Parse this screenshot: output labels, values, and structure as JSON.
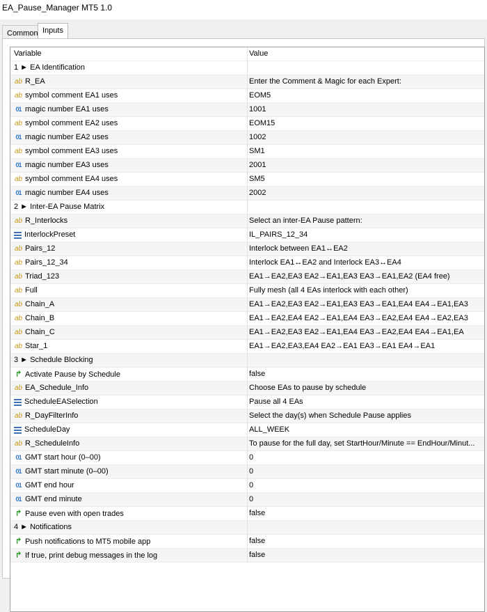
{
  "window": {
    "title": "EA_Pause_Manager MT5 1.0"
  },
  "tabs": [
    {
      "label": "Common"
    },
    {
      "label": "Inputs"
    }
  ],
  "table": {
    "headers": {
      "variable": "Variable",
      "value": "Value"
    },
    "rows": [
      {
        "kind": "group",
        "variable": "1 ► EA Identification",
        "value": ""
      },
      {
        "kind": "ab",
        "variable": "R_EA",
        "value": "Enter the Comment & Magic for each Expert:"
      },
      {
        "kind": "ab",
        "variable": "symbol comment EA1 uses",
        "value": "EOM5"
      },
      {
        "kind": "num",
        "variable": "magic number EA1 uses",
        "value": "1001"
      },
      {
        "kind": "ab",
        "variable": "symbol comment EA2 uses",
        "value": "EOM15"
      },
      {
        "kind": "num",
        "variable": "magic number EA2 uses",
        "value": "1002"
      },
      {
        "kind": "ab",
        "variable": "symbol comment EA3 uses",
        "value": "SM1"
      },
      {
        "kind": "num",
        "variable": "magic number EA3 uses",
        "value": "2001"
      },
      {
        "kind": "ab",
        "variable": "symbol comment EA4 uses",
        "value": "SM5"
      },
      {
        "kind": "num",
        "variable": "magic number EA4 uses",
        "value": "2002"
      },
      {
        "kind": "group",
        "variable": "2 ► Inter-EA Pause Matrix",
        "value": ""
      },
      {
        "kind": "ab",
        "variable": "R_Interlocks",
        "value": "Select an inter-EA Pause pattern:"
      },
      {
        "kind": "enum",
        "variable": "InterlockPreset",
        "value": "IL_PAIRS_12_34"
      },
      {
        "kind": "ab",
        "variable": "Pairs_12",
        "value": "Interlock between EA1↔EA2"
      },
      {
        "kind": "ab",
        "variable": "Pairs_12_34",
        "value": "Interlock EA1↔EA2  and Interlock  EA3↔EA4"
      },
      {
        "kind": "ab",
        "variable": "Triad_123",
        "value": "EA1→EA2,EA3  EA2→EA1,EA3  EA3→EA1,EA2  (EA4 free)"
      },
      {
        "kind": "ab",
        "variable": "Full",
        "value": "Fully mesh (all 4 EAs interlock with each other)"
      },
      {
        "kind": "ab",
        "variable": "Chain_A",
        "value": "EA1→EA2,EA3  EA2→EA1,EA3  EA3→EA1,EA4  EA4→EA1,EA3"
      },
      {
        "kind": "ab",
        "variable": "Chain_B",
        "value": "EA1→EA2,EA4  EA2→EA1,EA4  EA3→EA2,EA4  EA4→EA2,EA3"
      },
      {
        "kind": "ab",
        "variable": "Chain_C",
        "value": "EA1→EA2,EA3  EA2→EA1,EA4  EA3→EA2,EA4  EA4→EA1,EA"
      },
      {
        "kind": "ab",
        "variable": "Star_1",
        "value": "EA1→EA2,EA3,EA4  EA2→EA1  EA3→EA1  EA4→EA1"
      },
      {
        "kind": "group",
        "variable": "3 ► Schedule Blocking",
        "value": ""
      },
      {
        "kind": "bool",
        "variable": "Activate Pause by Schedule",
        "value": "false"
      },
      {
        "kind": "ab",
        "variable": "EA_Schedule_Info",
        "value": "Choose EAs to pause by schedule"
      },
      {
        "kind": "enum",
        "variable": "ScheduleEASelection",
        "value": "Pause all 4 EAs"
      },
      {
        "kind": "ab",
        "variable": "R_DayFilterInfo",
        "value": "Select the day(s) when Schedule Pause applies"
      },
      {
        "kind": "enum",
        "variable": "ScheduleDay",
        "value": "ALL_WEEK"
      },
      {
        "kind": "ab",
        "variable": "R_ScheduleInfo",
        "value": "To pause for the full day, set StartHour/Minute == EndHour/Minut..."
      },
      {
        "kind": "num",
        "variable": "GMT start hour (0–00)",
        "value": "0"
      },
      {
        "kind": "num",
        "variable": "GMT start minute (0–00)",
        "value": "0"
      },
      {
        "kind": "num",
        "variable": "GMT end hour",
        "value": "0"
      },
      {
        "kind": "num",
        "variable": "GMT end minute",
        "value": "0"
      },
      {
        "kind": "bool",
        "variable": "Pause even with open trades",
        "value": "false"
      },
      {
        "kind": "group",
        "variable": "4 ► Notifications",
        "value": ""
      },
      {
        "kind": "bool",
        "variable": "Push notifications to MT5 mobile app",
        "value": "false"
      },
      {
        "kind": "bool",
        "variable": "If true, print debug messages in the log",
        "value": "false"
      }
    ]
  },
  "icons": {
    "ab": "string-ab-icon",
    "num": "integer-01-icon",
    "enum": "enum-list-icon",
    "bool": "bool-arrow-icon"
  },
  "icon_text": {
    "ab": "ab",
    "num": "01",
    "bool": "↱"
  },
  "colors": {
    "ab": "#c8961e",
    "num": "#2f74c0",
    "enum": "#3b6fb6",
    "bool": "#2b9a2b"
  }
}
